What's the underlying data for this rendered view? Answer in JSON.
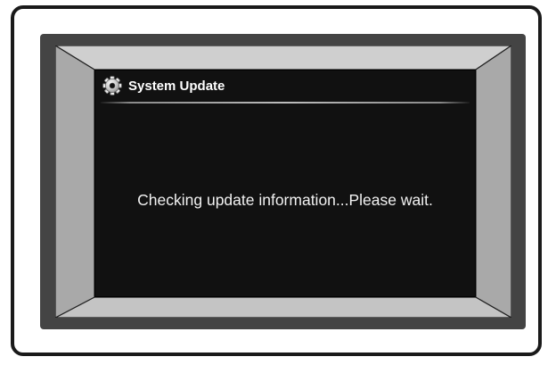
{
  "dialog": {
    "title": "System Update",
    "title_icon": "gear-icon",
    "message": "Checking update information...Please wait."
  },
  "colors": {
    "screen_background": "#111111",
    "text": "#ffffff",
    "bezel": "#444444",
    "frame_outer": "#1a1a1a"
  }
}
